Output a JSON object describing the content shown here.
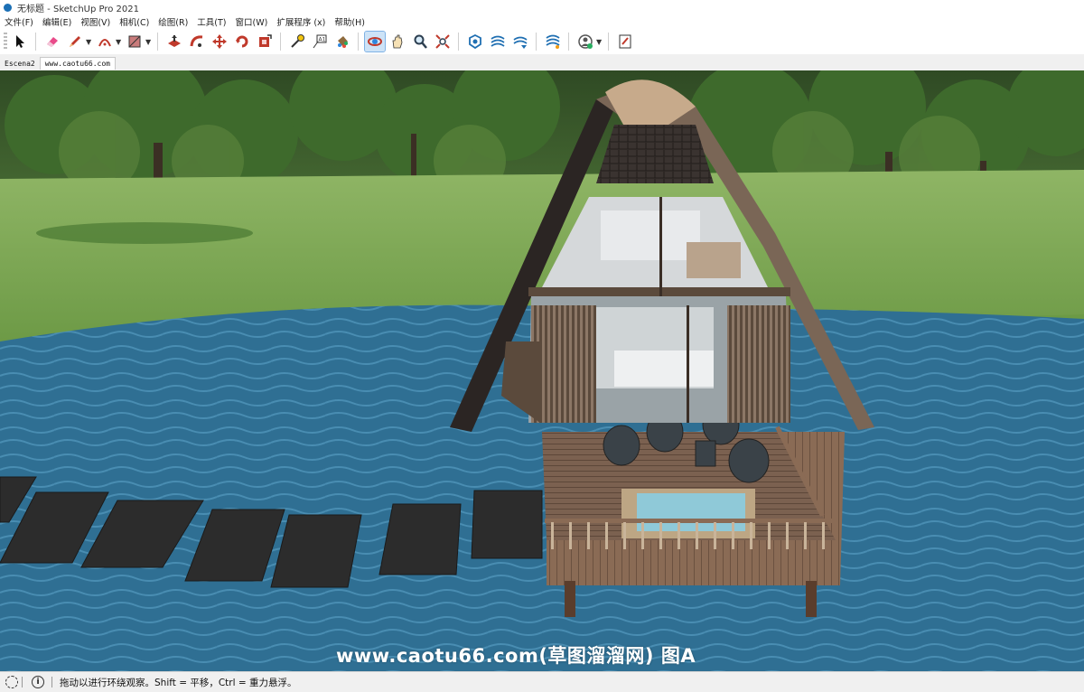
{
  "window": {
    "title": "无标题 - SketchUp Pro 2021"
  },
  "menu": [
    "文件(F)",
    "编辑(E)",
    "视图(V)",
    "相机(C)",
    "绘图(R)",
    "工具(T)",
    "窗口(W)",
    "扩展程序 (x)",
    "帮助(H)"
  ],
  "scene_tabs": [
    "Escena2",
    "www.caotu66.com"
  ],
  "active_tool": "orbit-icon",
  "watermark": "www.caotu66.com(草图溜溜网) 图A",
  "status": {
    "text": "拖动以进行环绕观察。Shift = 平移，Ctrl = 重力悬浮。"
  }
}
